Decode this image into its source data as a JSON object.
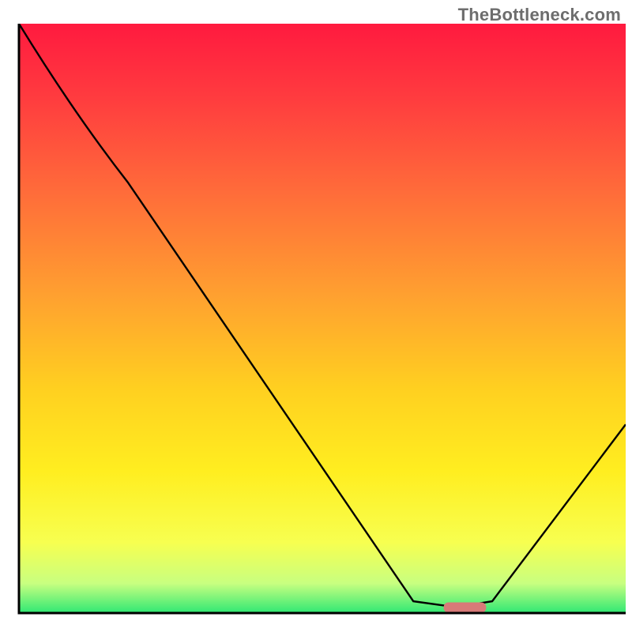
{
  "watermark": "TheBottleneck.com",
  "chart_data": {
    "type": "line",
    "title": "",
    "xlabel": "",
    "ylabel": "",
    "xlim": [
      0,
      100
    ],
    "ylim": [
      0,
      100
    ],
    "series": [
      {
        "name": "bottleneck-curve",
        "x": [
          0,
          18,
          65,
          72,
          78,
          100
        ],
        "y": [
          100,
          73,
          2,
          1,
          2,
          32
        ],
        "note": "y is percent of vertical span from bottom green band to top; 0 = on green band, 100 = top of plot"
      }
    ],
    "marker": {
      "name": "optimal-point",
      "x_range": [
        70,
        77
      ],
      "y": 1,
      "color": "#d87a78"
    },
    "background_gradient": {
      "stops": [
        {
          "pos": 0.0,
          "color": "#ff1a3f"
        },
        {
          "pos": 0.12,
          "color": "#ff3a3f"
        },
        {
          "pos": 0.28,
          "color": "#ff6a3a"
        },
        {
          "pos": 0.46,
          "color": "#ffa030"
        },
        {
          "pos": 0.62,
          "color": "#ffd020"
        },
        {
          "pos": 0.76,
          "color": "#ffee20"
        },
        {
          "pos": 0.88,
          "color": "#f7ff50"
        },
        {
          "pos": 0.95,
          "color": "#c8ff80"
        },
        {
          "pos": 1.0,
          "color": "#2fe874"
        }
      ]
    },
    "axes_color": "#000000",
    "axes_width": 3
  }
}
